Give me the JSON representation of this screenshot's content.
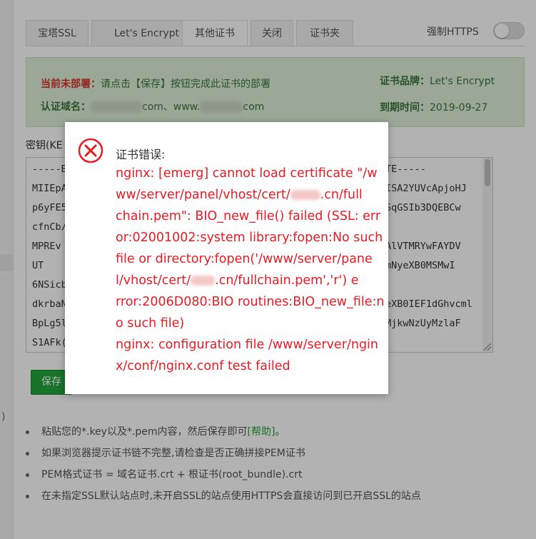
{
  "tabs": [
    "宝塔SSL",
    "Let's Encrypt",
    "其他证书",
    "关闭",
    "证书夹"
  ],
  "active_tab_index": 2,
  "force_https": {
    "label": "强制HTTPS",
    "enabled": false
  },
  "info": {
    "deploy_status_label": "当前未部署：",
    "deploy_status_text": "请点击【保存】按钮完成此证书的部署",
    "domain_label": "认证域名：",
    "domain_value_1": "com、www.",
    "domain_value_2": "com",
    "brand_label": "证书品牌：",
    "brand_value": "Let's Encrypt",
    "expiry_label": "到期时间：",
    "expiry_value": "2019-09-27"
  },
  "key_label": "密钥(KE",
  "key_lines_left": [
    "-----BE",
    "MIIEpA",
    "p6yFE5",
    "cfnCb/",
    "MPREv",
    "UT",
    "6NSicb",
    "dkrbaN",
    "BpLg5l",
    "S1AFk("
  ],
  "key_lines_right": [
    "TE-----",
    "ISA2YUVcApjoHJ",
    "SqGSIb3DQEBCw",
    "",
    "AlVTMRYwFAYDV",
    "mNyeXB0MSMwI",
    "",
    "eXB0IEF1dGhvcml",
    "MjkwNzUyMzlaF",
    ""
  ],
  "save_button": "保存",
  "left_glyph": ")",
  "tips": [
    {
      "text": "粘贴您的*.key以及*.pem内容，然后保存即可",
      "link": "[帮助]",
      "after": "。"
    },
    {
      "text": "如果浏览器提示证书链不完整,请检查是否正确拼接PEM证书"
    },
    {
      "text": "PEM格式证书 = 域名证书.crt + 根证书(root_bundle).crt"
    },
    {
      "text": "在未指定SSL默认站点时,未开启SSL的站点使用HTTPS会直接访问到已开启SSL的站点"
    }
  ],
  "dialog": {
    "icon": "error-x-icon",
    "title": "证书错误:",
    "message_lines": [
      "nginx: [emerg] cannot load certificate \"/w",
      "ww/server/panel/vhost/cert/",
      "chain.pem\": BIO_new_file() failed (SSL: err",
      "or:02001002:system library:fopen:No such",
      "file or directory:fopen('/www/server/pane",
      "l/vhost/cert/",
      "rror:2006D080:BIO routines:BIO_new_file:n",
      "o such file)",
      "nginx: configuration file /www/server/ngin",
      "x/conf/nginx.conf test failed"
    ],
    "line2_tail": ".cn/full",
    "line6_tail": ".cn/fullchain.pem','r') e"
  },
  "colors": {
    "accent_green": "#20a53a",
    "error_red": "#e51c23",
    "info_bg": "#dff0d8"
  }
}
